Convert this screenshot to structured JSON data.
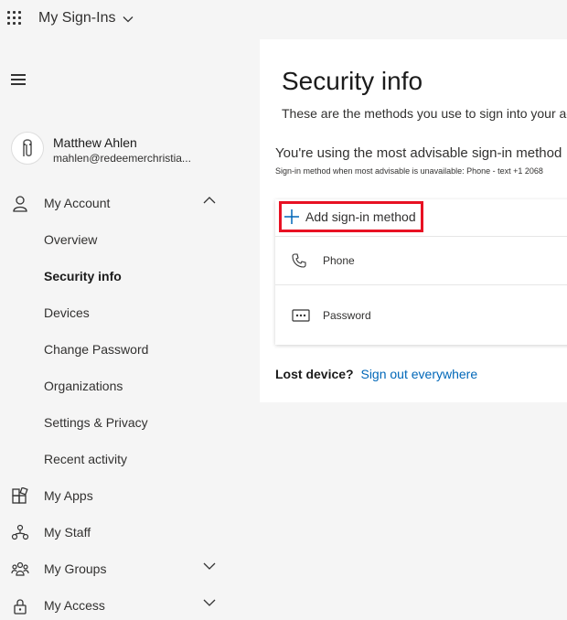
{
  "header": {
    "app_title": "My Sign-Ins",
    "waffle_icon": "waffle-icon",
    "dropdown_icon": "chevron-down-icon"
  },
  "sidebar": {
    "menu_icon": "hamburger-icon",
    "profile": {
      "name": "Matthew Ahlen",
      "email": "mahlen@redeemerchristia..."
    },
    "items": [
      {
        "label": "My Account",
        "icon": "person-icon",
        "expanded": true
      },
      {
        "label": "My Apps",
        "icon": "apps-icon"
      },
      {
        "label": "My Staff",
        "icon": "staff-icon"
      },
      {
        "label": "My Groups",
        "icon": "groups-icon",
        "expandable": true
      },
      {
        "label": "My Access",
        "icon": "lock-icon",
        "expandable": true
      }
    ],
    "sub_items": [
      {
        "label": "Overview"
      },
      {
        "label": "Security info",
        "active": true
      },
      {
        "label": "Devices"
      },
      {
        "label": "Change Password"
      },
      {
        "label": "Organizations"
      },
      {
        "label": "Settings & Privacy"
      },
      {
        "label": "Recent activity"
      }
    ]
  },
  "main": {
    "title": "Security info",
    "subtitle": "These are the methods you use to sign into your ac",
    "advisable_text": "You're using the most advisable sign-in method",
    "fallback_text": "Sign-in method when most advisable is unavailable: Phone - text +1 2068",
    "add_method_label": "Add sign-in method",
    "methods": [
      {
        "label": "Phone",
        "icon": "phone-icon"
      },
      {
        "label": "Password",
        "icon": "password-icon"
      }
    ],
    "lost_device_label": "Lost device?",
    "sign_out_link": "Sign out everywhere"
  },
  "colors": {
    "accent": "#0067b8",
    "highlight_border": "#e81123",
    "sidebar_bg": "#f5f5f5",
    "panel_bg": "#ffffff"
  }
}
